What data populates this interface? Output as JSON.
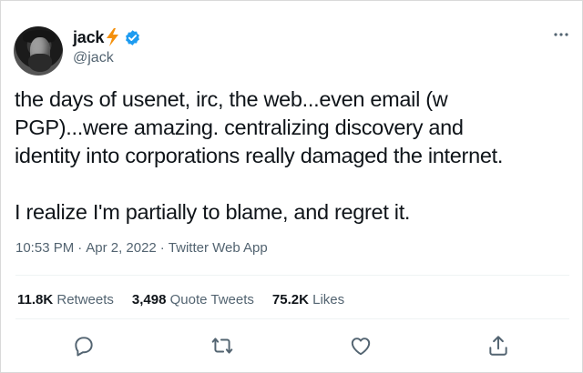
{
  "author": {
    "display_name": "jack",
    "handle": "@jack",
    "name_emoji_icon": "lightning-bolt-icon",
    "verified_icon": "verified-badge-icon"
  },
  "tweet": {
    "paragraph_1": "the days of usenet, irc, the web...even email (w\nPGP)...were amazing. centralizing discovery and\nidentity into corporations really damaged the internet.",
    "paragraph_2": "I realize I'm partially to blame, and regret it."
  },
  "meta": {
    "time": "10:53 PM",
    "separator": "·",
    "date": "Apr 2, 2022",
    "source": "Twitter Web App"
  },
  "stats": {
    "retweets_count": "11.8K",
    "retweets_label": "Retweets",
    "quotes_count": "3,498",
    "quotes_label": "Quote Tweets",
    "likes_count": "75.2K",
    "likes_label": "Likes"
  },
  "actions": [
    "reply-icon",
    "retweet-icon",
    "like-icon",
    "share-icon"
  ],
  "colors": {
    "text": "#0f1419",
    "secondary": "#536471",
    "verified": "#1d9bf0",
    "bolt": "#f4900c"
  }
}
